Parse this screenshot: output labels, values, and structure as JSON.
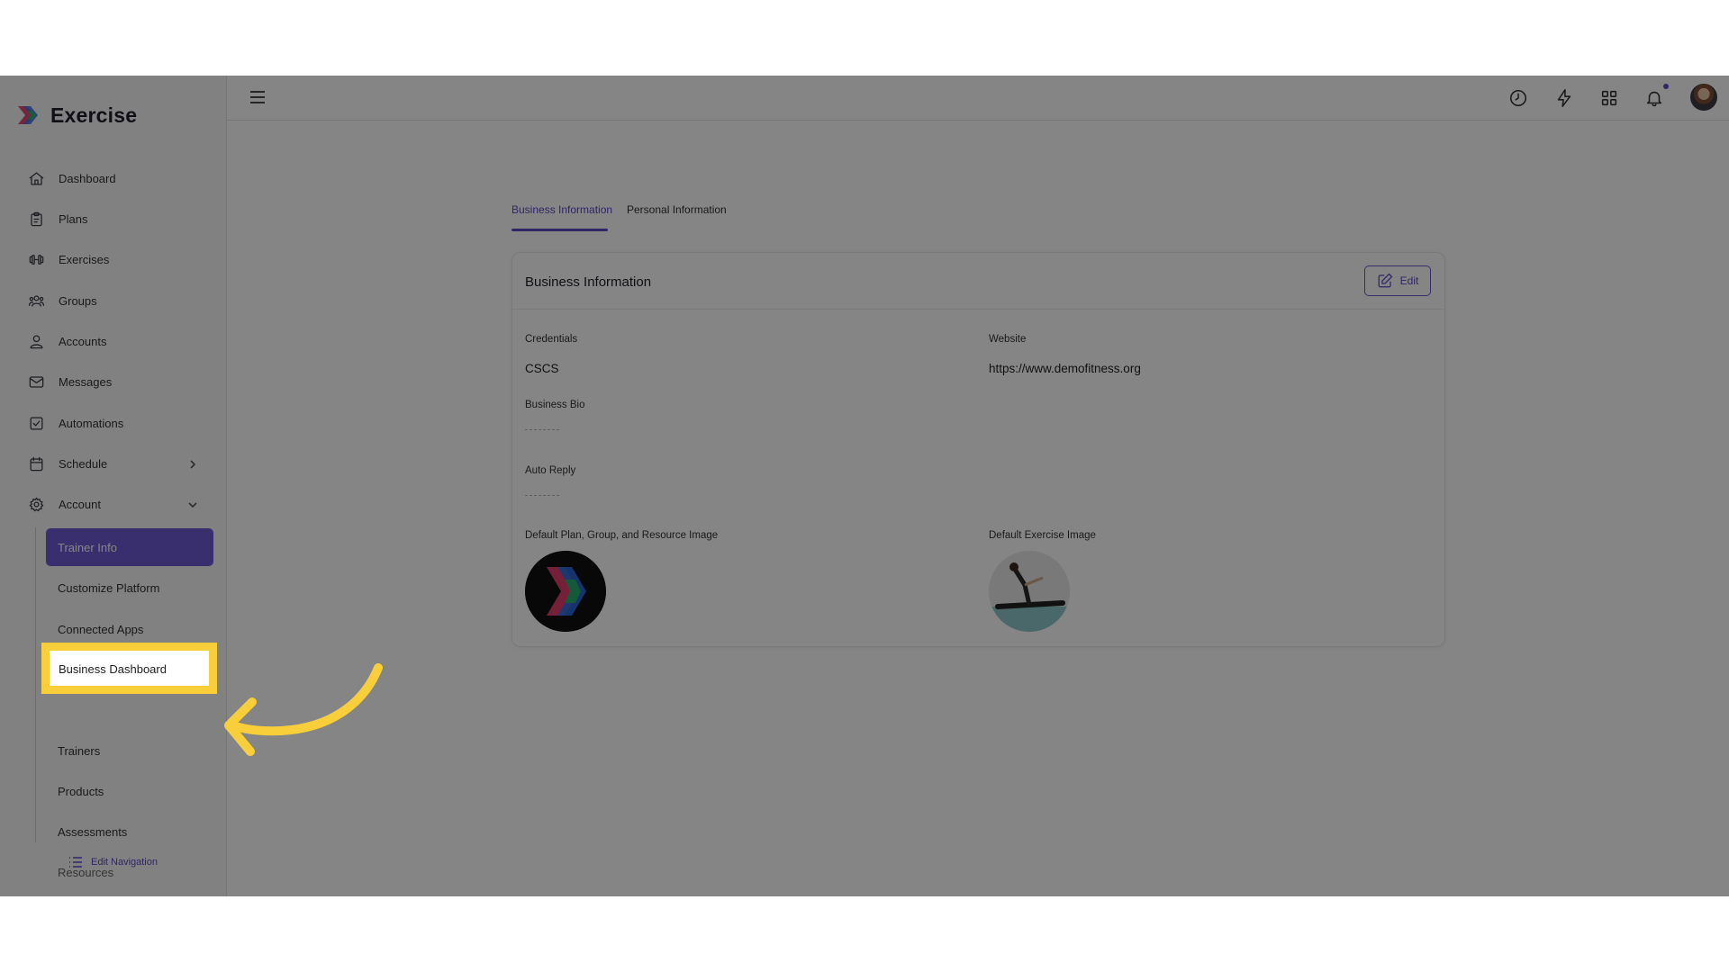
{
  "app": {
    "name": "Exercise"
  },
  "sidebar": {
    "items": [
      {
        "label": "Dashboard",
        "icon": "home-icon"
      },
      {
        "label": "Plans",
        "icon": "clipboard-icon"
      },
      {
        "label": "Exercises",
        "icon": "dumbbell-icon"
      },
      {
        "label": "Groups",
        "icon": "users-icon"
      },
      {
        "label": "Accounts",
        "icon": "user-icon"
      },
      {
        "label": "Messages",
        "icon": "mail-icon"
      },
      {
        "label": "Automations",
        "icon": "checkbox-icon"
      },
      {
        "label": "Schedule",
        "icon": "calendar-icon"
      },
      {
        "label": "Account",
        "icon": "gear-icon"
      }
    ],
    "account_subitems": [
      {
        "label": "Trainer Info",
        "active": true
      },
      {
        "label": "Customize Platform"
      },
      {
        "label": "Connected Apps"
      },
      {
        "label": "Business Dashboard",
        "highlighted": true
      },
      {
        "label": "Trainers"
      },
      {
        "label": "Products"
      },
      {
        "label": "Assessments"
      },
      {
        "label": "Resources"
      }
    ],
    "edit_navigation": "Edit Navigation"
  },
  "tabs": [
    {
      "label": "Business Information",
      "active": true
    },
    {
      "label": "Personal Information",
      "active": false
    }
  ],
  "card": {
    "title": "Business Information",
    "edit_label": "Edit",
    "fields": {
      "credentials_label": "Credentials",
      "credentials_value": "CSCS",
      "website_label": "Website",
      "website_value": "https://www.demofitness.org",
      "bio_label": "Business Bio",
      "auto_reply_label": "Auto Reply",
      "default_plan_image_label": "Default Plan, Group, and Resource Image",
      "default_exercise_image_label": "Default Exercise Image"
    }
  },
  "colors": {
    "accent": "#5b47c9",
    "active_bg": "#6f5bd3",
    "highlight": "#f8cf3b"
  }
}
